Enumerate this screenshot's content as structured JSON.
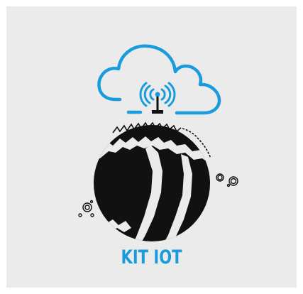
{
  "brand": {
    "title": "KIT IOT",
    "title_color": "#1a9cdc",
    "accent_color": "#1a9cdc",
    "ink_color": "#111111",
    "background_color": "#ebebeb"
  },
  "icons": {
    "cloud": "cloud-icon",
    "antenna": "wireless-antenna-icon",
    "ball": "striped-ball-icon"
  }
}
